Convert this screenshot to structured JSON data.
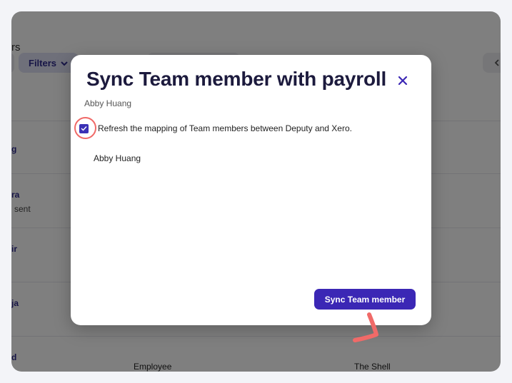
{
  "background": {
    "page_title_fragment": "rs",
    "filters_label": "Filters",
    "rows": [
      {
        "name": "g",
        "sub": ""
      },
      {
        "name": "ra",
        "sub": "sent"
      },
      {
        "name": "ir",
        "sub": ""
      },
      {
        "name": "ja",
        "sub": ""
      },
      {
        "name": "d",
        "role": "Employee",
        "location": "The Shell"
      }
    ]
  },
  "modal": {
    "title": "Sync Team member with payroll",
    "subtitle": "Abby Huang",
    "checkbox_label": "Refresh the mapping of Team members between Deputy and Xero.",
    "checkbox_checked": true,
    "member_name": "Abby Huang",
    "sync_button_label": "Sync Team member"
  },
  "colors": {
    "accent": "#3b27b5",
    "annotation": "#f06a68",
    "title": "#1c1a3d"
  },
  "icons": {
    "close": "close-icon",
    "check": "check-icon",
    "chevron": "chevron-down-icon",
    "back": "chevron-left-icon"
  }
}
